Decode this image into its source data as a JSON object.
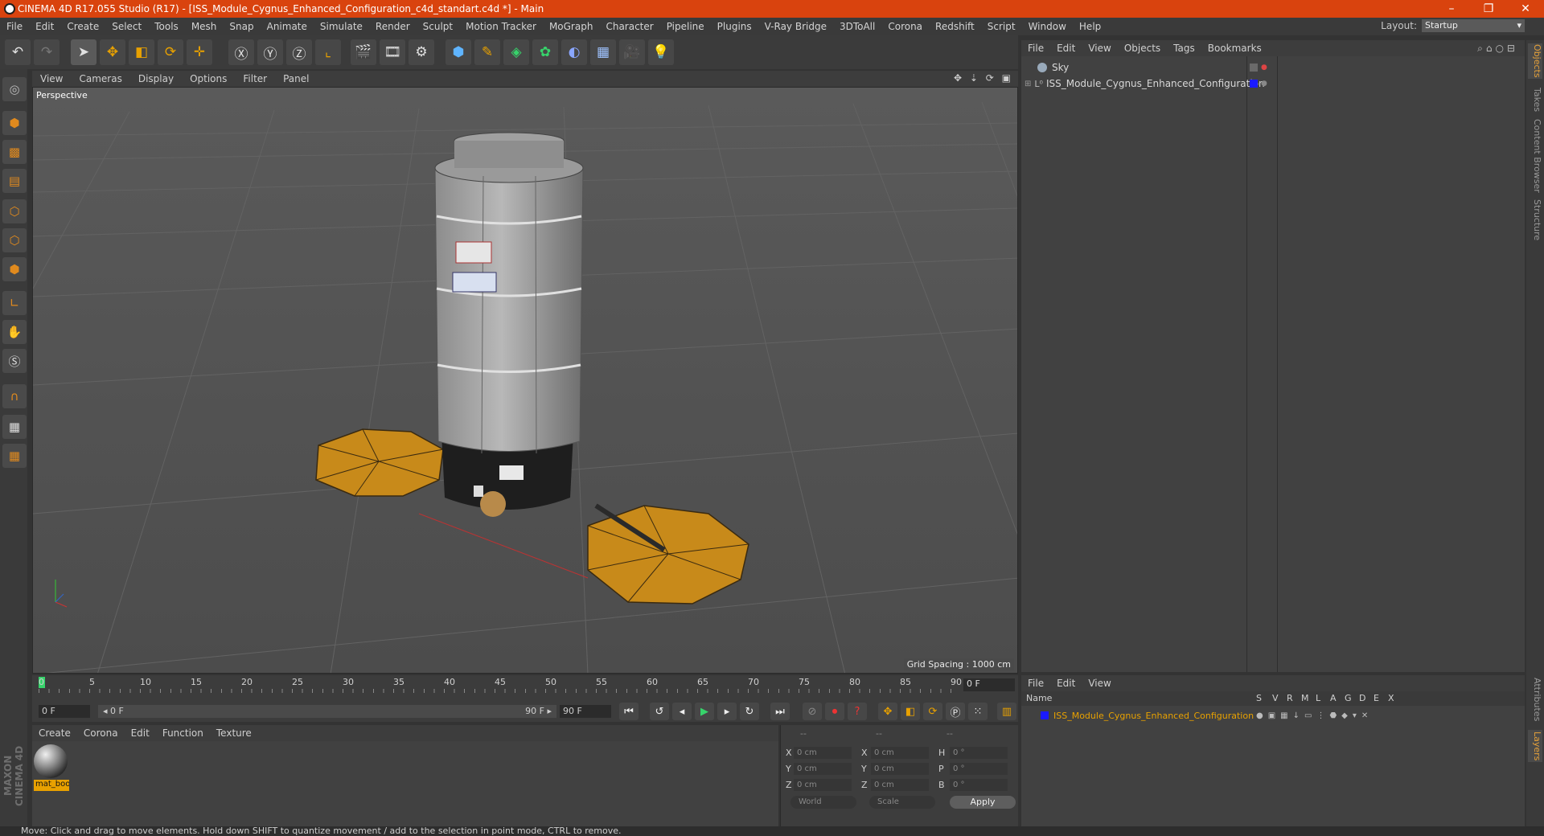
{
  "window": {
    "title": "CINEMA 4D R17.055 Studio (R17) - [ISS_Module_Cygnus_Enhanced_Configuration_c4d_standart.c4d *] - Main",
    "minimize": "–",
    "restore": "❐",
    "close": "✕"
  },
  "menubar": {
    "items": [
      "File",
      "Edit",
      "Create",
      "Select",
      "Tools",
      "Mesh",
      "Snap",
      "Animate",
      "Simulate",
      "Render",
      "Sculpt",
      "Motion Tracker",
      "MoGraph",
      "Character",
      "Pipeline",
      "Plugins",
      "V-Ray Bridge",
      "3DToAll",
      "Corona",
      "Redshift",
      "Script",
      "Window",
      "Help"
    ],
    "layout_label": "Layout:",
    "layout_value": "Startup"
  },
  "viewport": {
    "menu": [
      "View",
      "Cameras",
      "Display",
      "Options",
      "Filter",
      "Panel"
    ],
    "label": "Perspective",
    "grid_spacing": "Grid Spacing : 1000 cm",
    "nav_icons": "✥ ⇣ ⟳ ▣"
  },
  "timeline": {
    "ticks": [
      "0",
      "5",
      "10",
      "15",
      "20",
      "25",
      "30",
      "35",
      "40",
      "45",
      "50",
      "55",
      "60",
      "65",
      "70",
      "75",
      "80",
      "85",
      "90"
    ],
    "current_frame": "0 F",
    "start_field": "0 F",
    "range_start": "◂ 0 F",
    "range_end": "90 F ▸",
    "end_field": "90 F"
  },
  "materials": {
    "menu": [
      "Create",
      "Corona",
      "Edit",
      "Function",
      "Texture"
    ],
    "items": [
      {
        "name": "mat_boo"
      }
    ]
  },
  "coordinates": {
    "header": [
      "--",
      "--",
      "--"
    ],
    "rows": [
      {
        "l1": "X",
        "v1": "0 cm",
        "l2": "X",
        "v2": "0 cm",
        "l3": "H",
        "v3": "0 °"
      },
      {
        "l1": "Y",
        "v1": "0 cm",
        "l2": "Y",
        "v2": "0 cm",
        "l3": "P",
        "v3": "0 °"
      },
      {
        "l1": "Z",
        "v1": "0 cm",
        "l2": "Z",
        "v2": "0 cm",
        "l3": "B",
        "v3": "0 °"
      }
    ],
    "mode": "World",
    "scale": "Scale",
    "apply": "Apply"
  },
  "objects": {
    "menu": [
      "File",
      "Edit",
      "View",
      "Objects",
      "Tags",
      "Bookmarks"
    ],
    "rows": [
      {
        "name": "Sky"
      },
      {
        "name": "ISS_Module_Cygnus_Enhanced_Configuration"
      }
    ]
  },
  "layers": {
    "menu": [
      "File",
      "Edit",
      "View"
    ],
    "header_name": "Name",
    "columns": [
      "S",
      "V",
      "R",
      "M",
      "L",
      "A",
      "G",
      "D",
      "E",
      "X"
    ],
    "rows": [
      {
        "name": "ISS_Module_Cygnus_Enhanced_Configuration",
        "color": "#1a1aff"
      }
    ]
  },
  "right_tabs": [
    "Objects",
    "Takes",
    "Content Browser",
    "Structure",
    "Attributes",
    "Layers"
  ],
  "statusbar": {
    "text": "Move: Click and drag to move elements. Hold down SHIFT to quantize movement / add to the selection in point mode, CTRL to remove."
  },
  "brand": {
    "logo": "MAXON CINEMA 4D"
  },
  "colors": {
    "accent": "#d9430e",
    "selection": "#e8a100",
    "layer": "#1a1aff"
  }
}
